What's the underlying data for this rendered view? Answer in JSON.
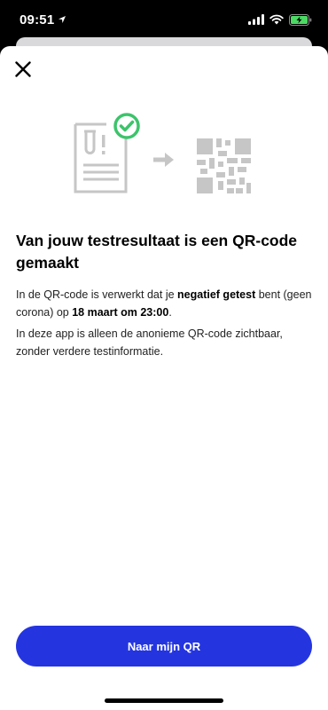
{
  "status_bar": {
    "time": "09:51",
    "icons": [
      "location-arrow-icon",
      "cellular-signal-icon",
      "wifi-icon",
      "battery-charging-icon"
    ]
  },
  "colors": {
    "primary": "#2435e0",
    "success": "#3cc46b",
    "illustration_gray": "#c6c6c6"
  },
  "content": {
    "title": "Van jouw testresultaat is een QR-code gemaakt",
    "p1_intro": "In de QR-code is verwerkt dat je ",
    "p1_result": "negatief getest",
    "p1_middle": " bent (geen corona) op ",
    "p1_datetime": "18 maart om 23:00",
    "p1_end": ".",
    "p2": "In deze app is alleen de anonieme QR-code zichtbaar, zonder verdere testinformatie."
  },
  "actions": {
    "primary_label": "Naar mijn QR"
  }
}
